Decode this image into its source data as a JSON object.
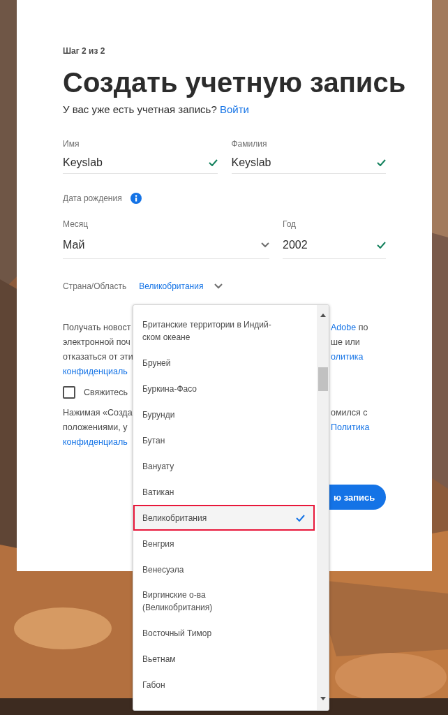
{
  "step": "Шаг 2 из 2",
  "title": "Создать учетную запись",
  "signin": {
    "prompt": "У вас уже есть учетная запись?",
    "link": "Войти"
  },
  "name_fields": [
    {
      "label": "Имя",
      "value": "Keyslab",
      "valid": true
    },
    {
      "label": "Фамилия",
      "value": "Keyslab",
      "valid": true
    }
  ],
  "birth_date": {
    "label": "Дата рождения",
    "month": {
      "label": "Месяц",
      "value": "Май"
    },
    "year": {
      "label": "Год",
      "value": "2002",
      "valid": true
    }
  },
  "country": {
    "label": "Страна/Область",
    "value": "Великобритания",
    "expanded": true,
    "options": [
      {
        "label": "Британские территории в Индий-\nском океане",
        "selected": false
      },
      {
        "label": "Бруней",
        "selected": false
      },
      {
        "label": "Буркина-Фасо",
        "selected": false
      },
      {
        "label": "Бурунди",
        "selected": false
      },
      {
        "label": "Бутан",
        "selected": false
      },
      {
        "label": "Вануату",
        "selected": false
      },
      {
        "label": "Ватикан",
        "selected": false
      },
      {
        "label": "Великобритания",
        "selected": true
      },
      {
        "label": "Венгрия",
        "selected": false
      },
      {
        "label": "Венесуэла",
        "selected": false
      },
      {
        "label": "Виргинские о-ва\n(Великобритания)",
        "selected": false
      },
      {
        "label": "Восточный Тимор",
        "selected": false
      },
      {
        "label": "Вьетнам",
        "selected": false
      },
      {
        "label": "Габон",
        "selected": false
      }
    ]
  },
  "behind_rows": [
    {
      "kind": "text",
      "left": [
        {
          "text": "Получать новост",
          "link": false
        }
      ],
      "right": [
        {
          "text": "Adobe",
          "link": true
        },
        {
          "text": " по",
          "link": false
        }
      ]
    },
    {
      "kind": "text",
      "left": [
        {
          "text": "электронной поч",
          "link": false
        }
      ],
      "right": [
        {
          "text": "ше или",
          "link": false
        }
      ]
    },
    {
      "kind": "text",
      "left": [
        {
          "text": "отказаться от эти",
          "link": false
        }
      ],
      "right": [
        {
          "text": "олитика",
          "link": true
        }
      ]
    },
    {
      "kind": "text",
      "left": [
        {
          "text": "конфиденциаль",
          "link": true
        }
      ],
      "right": []
    },
    {
      "kind": "checkbox",
      "label": "Свяжитесь",
      "checked": false
    },
    {
      "kind": "text",
      "left": [
        {
          "text": "Нажимая «Созда",
          "link": false
        }
      ],
      "right": [
        {
          "text": "омился с",
          "link": false
        }
      ]
    },
    {
      "kind": "text",
      "left": [
        {
          "text": "положениями, у",
          "link": false
        }
      ],
      "right": [
        {
          "text": "Политика",
          "link": true
        }
      ]
    },
    {
      "kind": "text",
      "left": [
        {
          "text": "конфиденциаль",
          "link": true
        }
      ],
      "right": []
    }
  ],
  "submit": {
    "label": "ю запись"
  }
}
